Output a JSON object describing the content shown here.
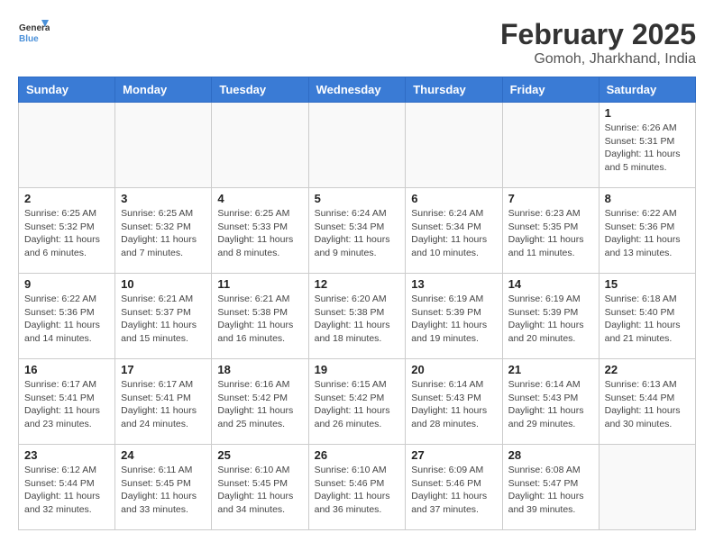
{
  "header": {
    "logo_line1": "General",
    "logo_line2": "Blue",
    "month_title": "February 2025",
    "location": "Gomoh, Jharkhand, India"
  },
  "days_of_week": [
    "Sunday",
    "Monday",
    "Tuesday",
    "Wednesday",
    "Thursday",
    "Friday",
    "Saturday"
  ],
  "weeks": [
    [
      {
        "day": "",
        "info": ""
      },
      {
        "day": "",
        "info": ""
      },
      {
        "day": "",
        "info": ""
      },
      {
        "day": "",
        "info": ""
      },
      {
        "day": "",
        "info": ""
      },
      {
        "day": "",
        "info": ""
      },
      {
        "day": "1",
        "info": "Sunrise: 6:26 AM\nSunset: 5:31 PM\nDaylight: 11 hours\nand 5 minutes."
      }
    ],
    [
      {
        "day": "2",
        "info": "Sunrise: 6:25 AM\nSunset: 5:32 PM\nDaylight: 11 hours\nand 6 minutes."
      },
      {
        "day": "3",
        "info": "Sunrise: 6:25 AM\nSunset: 5:32 PM\nDaylight: 11 hours\nand 7 minutes."
      },
      {
        "day": "4",
        "info": "Sunrise: 6:25 AM\nSunset: 5:33 PM\nDaylight: 11 hours\nand 8 minutes."
      },
      {
        "day": "5",
        "info": "Sunrise: 6:24 AM\nSunset: 5:34 PM\nDaylight: 11 hours\nand 9 minutes."
      },
      {
        "day": "6",
        "info": "Sunrise: 6:24 AM\nSunset: 5:34 PM\nDaylight: 11 hours\nand 10 minutes."
      },
      {
        "day": "7",
        "info": "Sunrise: 6:23 AM\nSunset: 5:35 PM\nDaylight: 11 hours\nand 11 minutes."
      },
      {
        "day": "8",
        "info": "Sunrise: 6:22 AM\nSunset: 5:36 PM\nDaylight: 11 hours\nand 13 minutes."
      }
    ],
    [
      {
        "day": "9",
        "info": "Sunrise: 6:22 AM\nSunset: 5:36 PM\nDaylight: 11 hours\nand 14 minutes."
      },
      {
        "day": "10",
        "info": "Sunrise: 6:21 AM\nSunset: 5:37 PM\nDaylight: 11 hours\nand 15 minutes."
      },
      {
        "day": "11",
        "info": "Sunrise: 6:21 AM\nSunset: 5:38 PM\nDaylight: 11 hours\nand 16 minutes."
      },
      {
        "day": "12",
        "info": "Sunrise: 6:20 AM\nSunset: 5:38 PM\nDaylight: 11 hours\nand 18 minutes."
      },
      {
        "day": "13",
        "info": "Sunrise: 6:19 AM\nSunset: 5:39 PM\nDaylight: 11 hours\nand 19 minutes."
      },
      {
        "day": "14",
        "info": "Sunrise: 6:19 AM\nSunset: 5:39 PM\nDaylight: 11 hours\nand 20 minutes."
      },
      {
        "day": "15",
        "info": "Sunrise: 6:18 AM\nSunset: 5:40 PM\nDaylight: 11 hours\nand 21 minutes."
      }
    ],
    [
      {
        "day": "16",
        "info": "Sunrise: 6:17 AM\nSunset: 5:41 PM\nDaylight: 11 hours\nand 23 minutes."
      },
      {
        "day": "17",
        "info": "Sunrise: 6:17 AM\nSunset: 5:41 PM\nDaylight: 11 hours\nand 24 minutes."
      },
      {
        "day": "18",
        "info": "Sunrise: 6:16 AM\nSunset: 5:42 PM\nDaylight: 11 hours\nand 25 minutes."
      },
      {
        "day": "19",
        "info": "Sunrise: 6:15 AM\nSunset: 5:42 PM\nDaylight: 11 hours\nand 26 minutes."
      },
      {
        "day": "20",
        "info": "Sunrise: 6:14 AM\nSunset: 5:43 PM\nDaylight: 11 hours\nand 28 minutes."
      },
      {
        "day": "21",
        "info": "Sunrise: 6:14 AM\nSunset: 5:43 PM\nDaylight: 11 hours\nand 29 minutes."
      },
      {
        "day": "22",
        "info": "Sunrise: 6:13 AM\nSunset: 5:44 PM\nDaylight: 11 hours\nand 30 minutes."
      }
    ],
    [
      {
        "day": "23",
        "info": "Sunrise: 6:12 AM\nSunset: 5:44 PM\nDaylight: 11 hours\nand 32 minutes."
      },
      {
        "day": "24",
        "info": "Sunrise: 6:11 AM\nSunset: 5:45 PM\nDaylight: 11 hours\nand 33 minutes."
      },
      {
        "day": "25",
        "info": "Sunrise: 6:10 AM\nSunset: 5:45 PM\nDaylight: 11 hours\nand 34 minutes."
      },
      {
        "day": "26",
        "info": "Sunrise: 6:10 AM\nSunset: 5:46 PM\nDaylight: 11 hours\nand 36 minutes."
      },
      {
        "day": "27",
        "info": "Sunrise: 6:09 AM\nSunset: 5:46 PM\nDaylight: 11 hours\nand 37 minutes."
      },
      {
        "day": "28",
        "info": "Sunrise: 6:08 AM\nSunset: 5:47 PM\nDaylight: 11 hours\nand 39 minutes."
      },
      {
        "day": "",
        "info": ""
      }
    ]
  ]
}
